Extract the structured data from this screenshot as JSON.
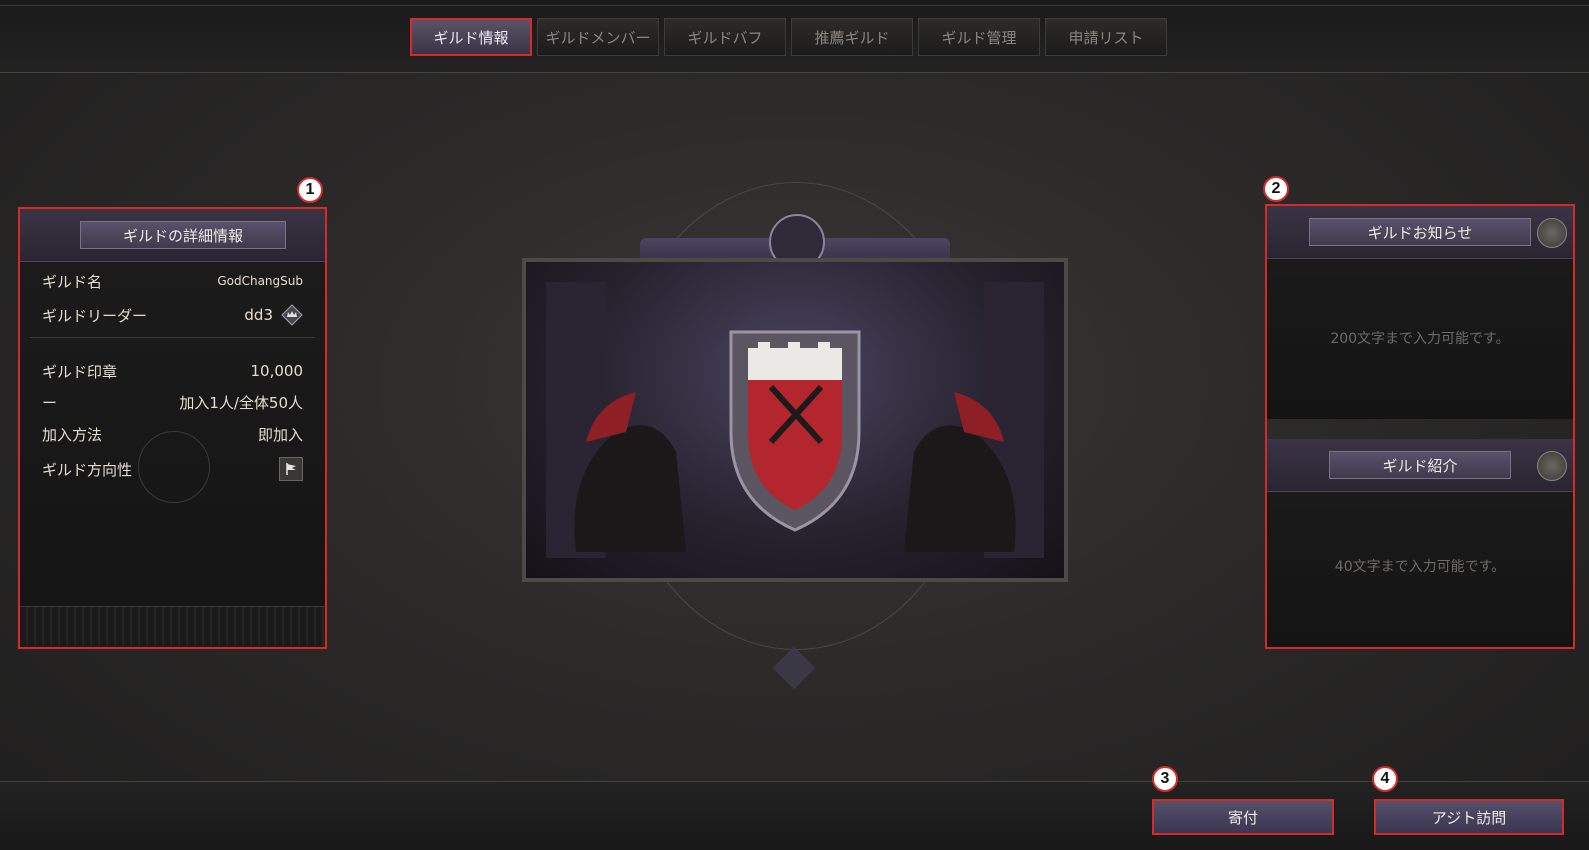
{
  "tabs": [
    "ギルド情報",
    "ギルドメンバー",
    "ギルドバフ",
    "推薦ギルド",
    "ギルド管理",
    "申請リスト"
  ],
  "details": {
    "title": "ギルドの詳細情報",
    "rows": [
      {
        "label": "ギルド名",
        "value": "GodChangSub"
      },
      {
        "label": "ギルドリーダー",
        "value": "dd3"
      },
      {
        "label": "ギルド印章",
        "value": "10,000"
      },
      {
        "label": "ー",
        "value": "加入1人/全体50人"
      },
      {
        "label": "加入方法",
        "value": "即加入"
      },
      {
        "label": "ギルド方向性",
        "value": ""
      }
    ]
  },
  "notice": {
    "title": "ギルドお知らせ",
    "placeholder": "200文字まで入力可能です。"
  },
  "intro": {
    "title": "ギルド紹介",
    "placeholder": "40文字まで入力可能です。"
  },
  "buttons": {
    "donate": "寄付",
    "visit": "アジト訪問"
  },
  "markers": [
    "1",
    "2",
    "3",
    "4"
  ],
  "colors": {
    "highlight": "#d42a2a",
    "shield_red": "#b3262e"
  }
}
